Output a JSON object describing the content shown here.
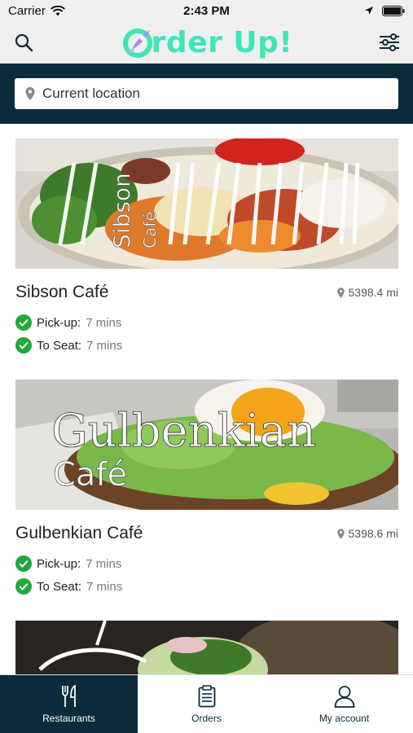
{
  "status_bar": {
    "carrier": "Carrier",
    "time": "2:43 PM"
  },
  "header": {
    "brand": "rder Up!",
    "brand_color": "#3ee6b8",
    "search_icon": "search-icon",
    "filter_icon": "filter-sliders-icon"
  },
  "location": {
    "placeholder": "Current location"
  },
  "restaurants": [
    {
      "name": "Sibson Café",
      "distance": "5398.4 mi",
      "image_title": "Sibson",
      "image_subtitle": "Café",
      "pickup_label": "Pick-up:",
      "pickup_time": "7 mins",
      "seat_label": "To Seat:",
      "seat_time": "7 mins"
    },
    {
      "name": "Gulbenkian Café",
      "distance": "5398.6 mi",
      "image_title": "Gulbenkian",
      "image_subtitle": "Café",
      "pickup_label": "Pick-up:",
      "pickup_time": "7 mins",
      "seat_label": "To Seat:",
      "seat_time": "7 mins"
    }
  ],
  "tabs": [
    {
      "label": "Restaurants",
      "icon": "fork-knife-icon",
      "active": true
    },
    {
      "label": "Orders",
      "icon": "clipboard-icon",
      "active": false
    },
    {
      "label": "My account",
      "icon": "user-icon",
      "active": false
    }
  ],
  "colors": {
    "navy": "#0c2a3a",
    "accent": "#3ee6b8",
    "check": "#1fa83b"
  }
}
